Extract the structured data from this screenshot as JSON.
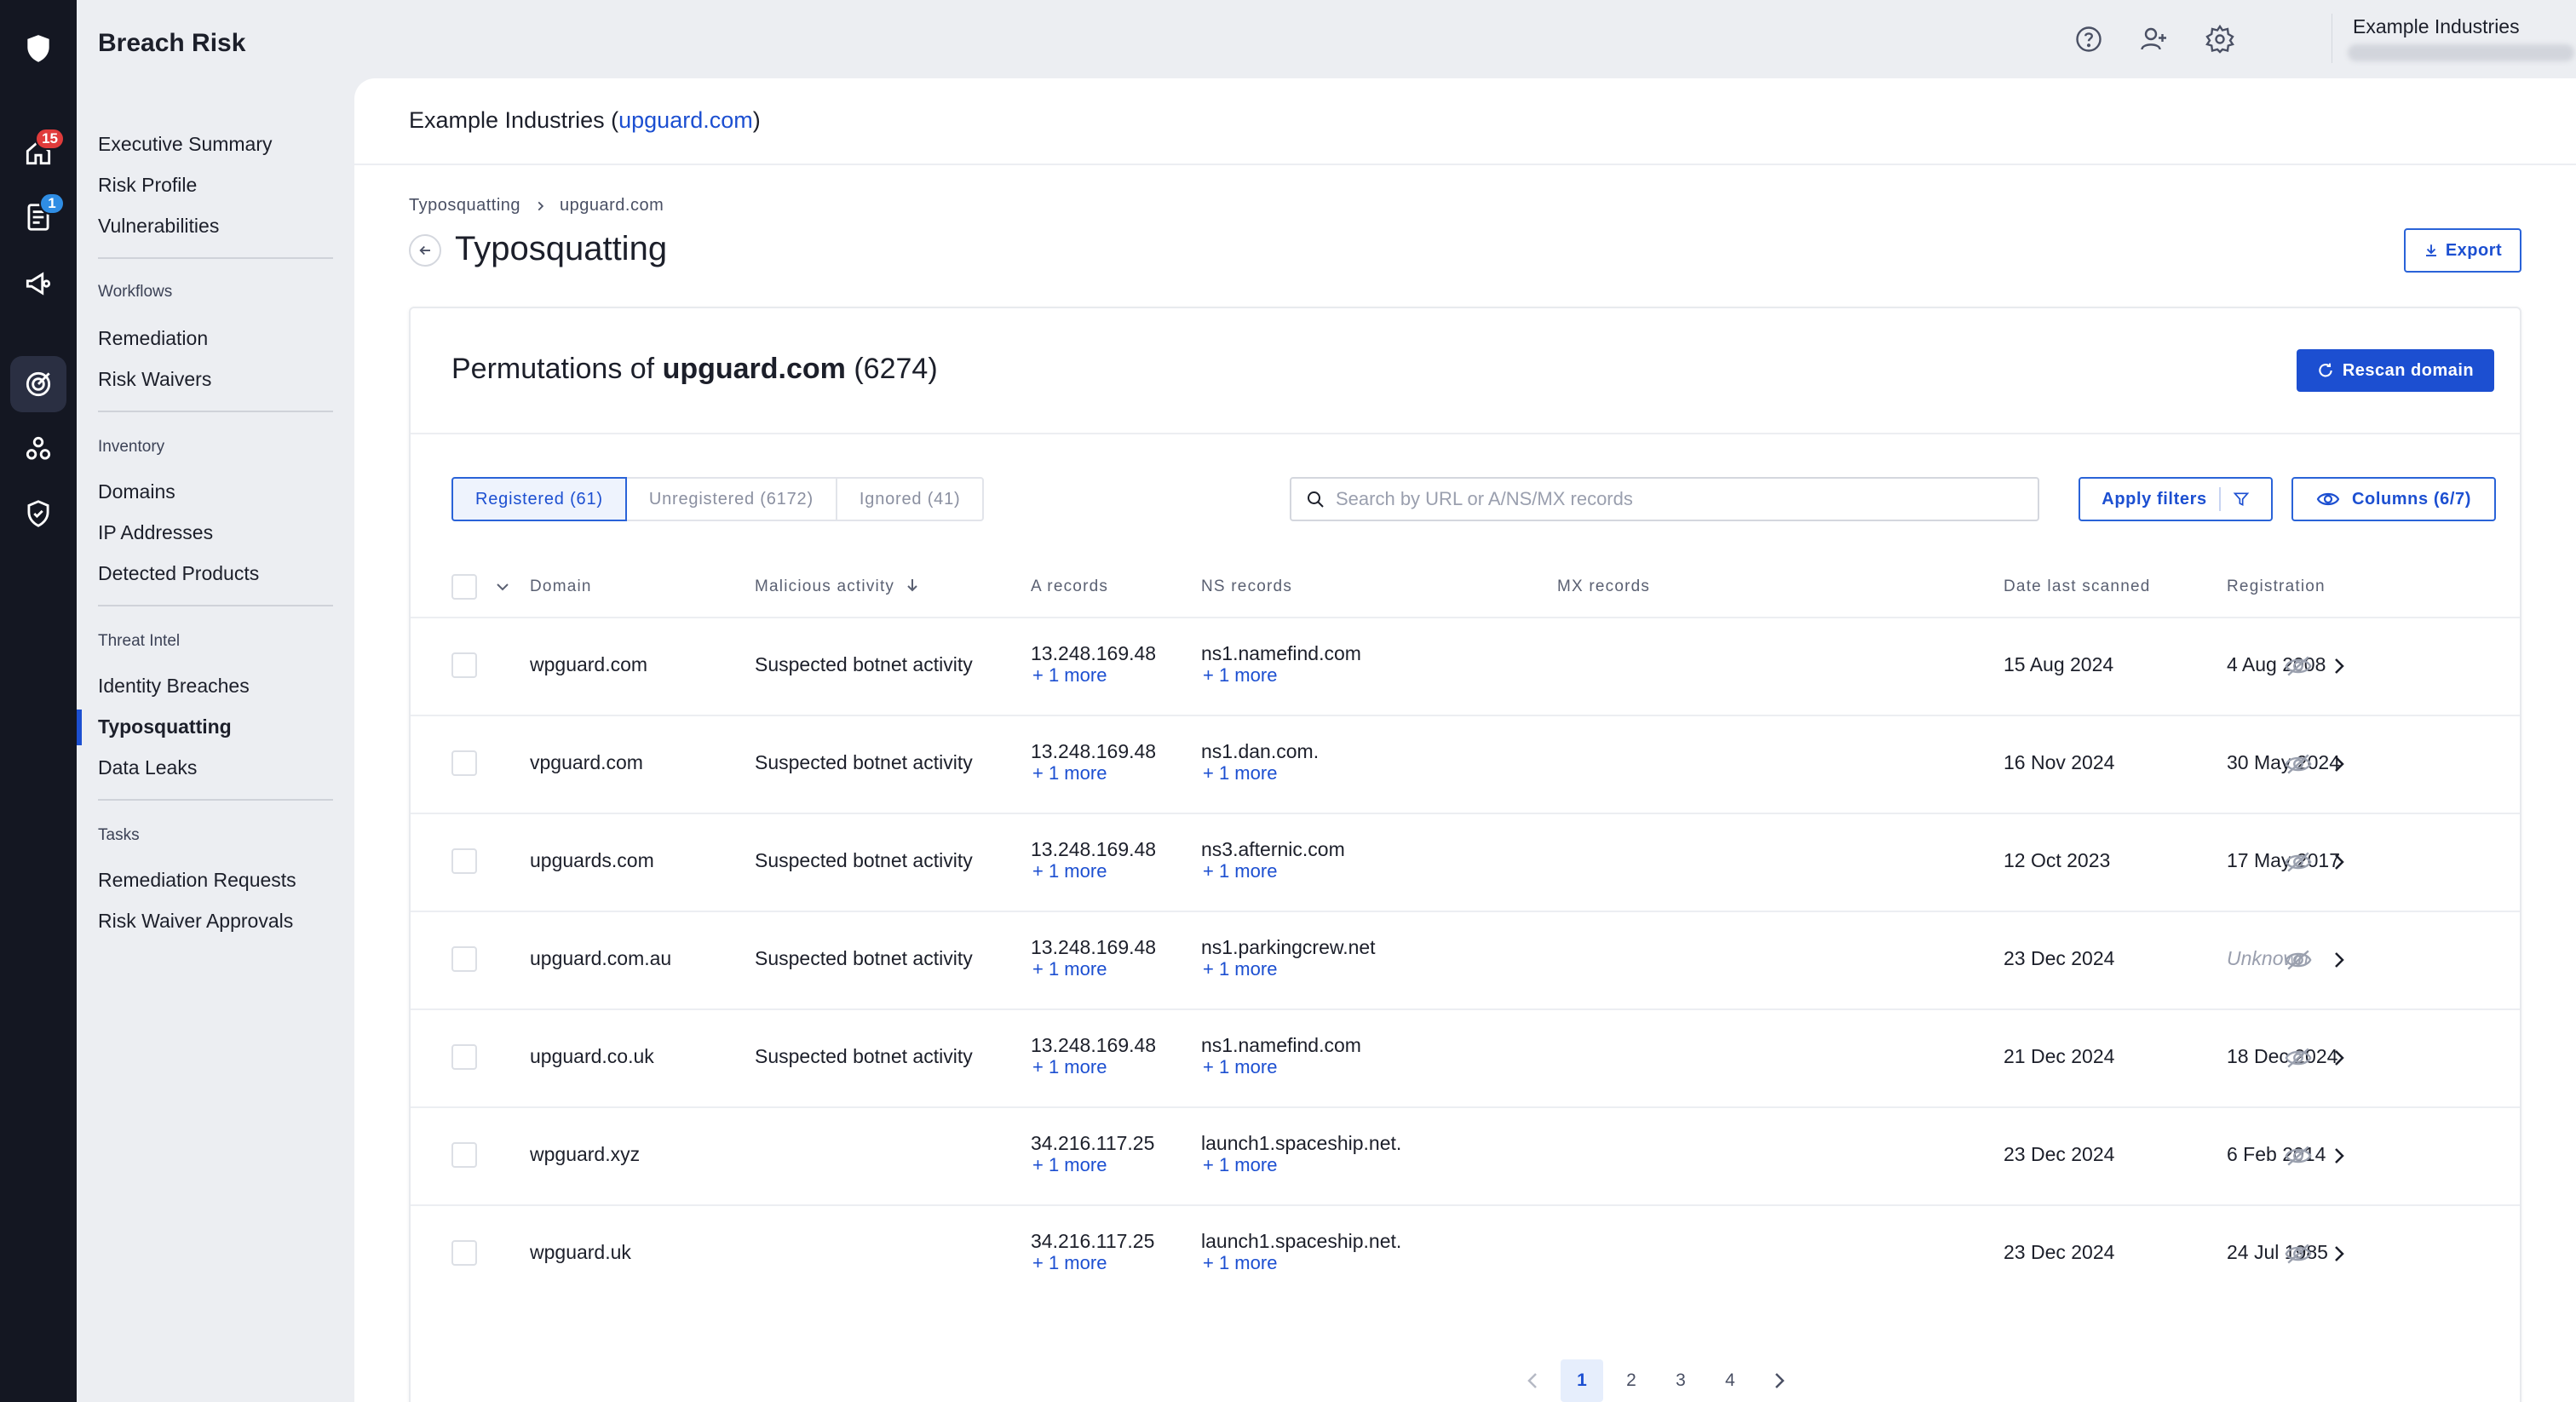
{
  "app": {
    "title": "Breach Risk"
  },
  "rail": {
    "badges": {
      "home": "15",
      "reports": "1"
    }
  },
  "topbar": {
    "org_name": "Example Industries"
  },
  "sidebar": {
    "items_top": [
      "Executive Summary",
      "Risk Profile",
      "Vulnerabilities"
    ],
    "workflows_title": "Workflows",
    "workflows": [
      "Remediation",
      "Risk Waivers"
    ],
    "inventory_title": "Inventory",
    "inventory": [
      "Domains",
      "IP Addresses",
      "Detected Products"
    ],
    "threat_title": "Threat Intel",
    "threat": [
      "Identity Breaches",
      "Typosquatting",
      "Data Leaks"
    ],
    "tasks_title": "Tasks",
    "tasks": [
      "Remediation Requests",
      "Risk Waiver Approvals"
    ]
  },
  "main": {
    "header_org": "Example Industries",
    "header_domain": "upguard.com",
    "breadcrumb": [
      "Typosquatting",
      "upguard.com"
    ],
    "title": "Typosquatting",
    "export_label": "Export"
  },
  "card": {
    "title_prefix": "Permutations of ",
    "title_domain": "upguard.com",
    "title_count": "(6274)",
    "rescan_label": "Rescan domain",
    "tabs": [
      "Registered (61)",
      "Unregistered (6172)",
      "Ignored (41)"
    ],
    "search_placeholder": "Search by URL or A/NS/MX records",
    "apply_filters_label": "Apply filters",
    "columns_label": "Columns (6/7)"
  },
  "table": {
    "headers": [
      "Domain",
      "Malicious activity",
      "A records",
      "NS records",
      "MX records",
      "Date last scanned",
      "Registration"
    ],
    "rows": [
      {
        "domain": "wpguard.com",
        "malicious": "Suspected botnet activity",
        "a": "13.248.169.48",
        "a_more": "+ 1 more",
        "ns": "ns1.namefind.com",
        "ns_more": "+ 1 more",
        "scanned": "15 Aug 2024",
        "registration": "4 Aug 2008"
      },
      {
        "domain": "vpguard.com",
        "malicious": "Suspected botnet activity",
        "a": "13.248.169.48",
        "a_more": "+ 1 more",
        "ns": "ns1.dan.com.",
        "ns_more": "+ 1 more",
        "scanned": "16 Nov 2024",
        "registration": "30 May 2024"
      },
      {
        "domain": "upguards.com",
        "malicious": "Suspected botnet activity",
        "a": "13.248.169.48",
        "a_more": "+ 1 more",
        "ns": "ns3.afternic.com",
        "ns_more": "+ 1 more",
        "scanned": "12 Oct 2023",
        "registration": "17 May 2017"
      },
      {
        "domain": "upguard.com.au",
        "malicious": "Suspected botnet activity",
        "a": "13.248.169.48",
        "a_more": "+ 1 more",
        "ns": "ns1.parkingcrew.net",
        "ns_more": "+ 1 more",
        "scanned": "23 Dec 2024",
        "registration": "Unknown"
      },
      {
        "domain": "upguard.co.uk",
        "malicious": "Suspected botnet activity",
        "a": "13.248.169.48",
        "a_more": "+ 1 more",
        "ns": "ns1.namefind.com",
        "ns_more": "+ 1 more",
        "scanned": "21 Dec 2024",
        "registration": "18 Dec 2024"
      },
      {
        "domain": "wpguard.xyz",
        "malicious": "",
        "a": "34.216.117.25",
        "a_more": "+ 1 more",
        "ns": "launch1.spaceship.net.",
        "ns_more": "+ 1 more",
        "scanned": "23 Dec 2024",
        "registration": "6 Feb 2014"
      },
      {
        "domain": "wpguard.uk",
        "malicious": "",
        "a": "34.216.117.25",
        "a_more": "+ 1 more",
        "ns": "launch1.spaceship.net.",
        "ns_more": "+ 1 more",
        "scanned": "23 Dec 2024",
        "registration": "24 Jul 1985"
      }
    ]
  },
  "pagination": {
    "pages": [
      "1",
      "2",
      "3",
      "4"
    ],
    "current": "1"
  },
  "colors": {
    "accent": "#1c4fd1",
    "rail": "#141722",
    "badge_red": "#e03b3b",
    "badge_blue": "#2f8de4"
  }
}
